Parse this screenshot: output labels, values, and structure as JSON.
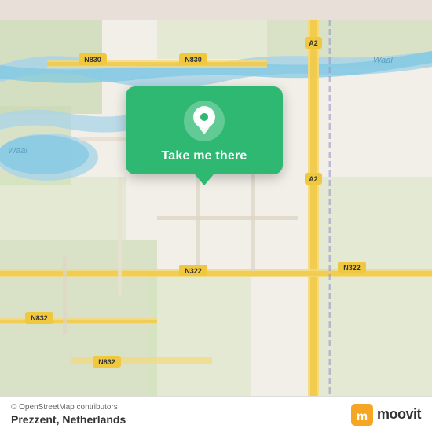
{
  "map": {
    "background_color": "#e8e0d8",
    "center_lat": 51.82,
    "center_lon": 5.85
  },
  "popup": {
    "button_label": "Take me there",
    "background_color": "#2eb872"
  },
  "bottom_bar": {
    "credit": "© OpenStreetMap contributors",
    "location_name": "Prezzent, Netherlands",
    "logo_text": "moovit"
  },
  "road_labels": [
    "N830",
    "N830",
    "N322",
    "N322",
    "N832",
    "N832",
    "A2",
    "A2",
    "Waal"
  ],
  "icons": {
    "location_pin": "📍"
  }
}
